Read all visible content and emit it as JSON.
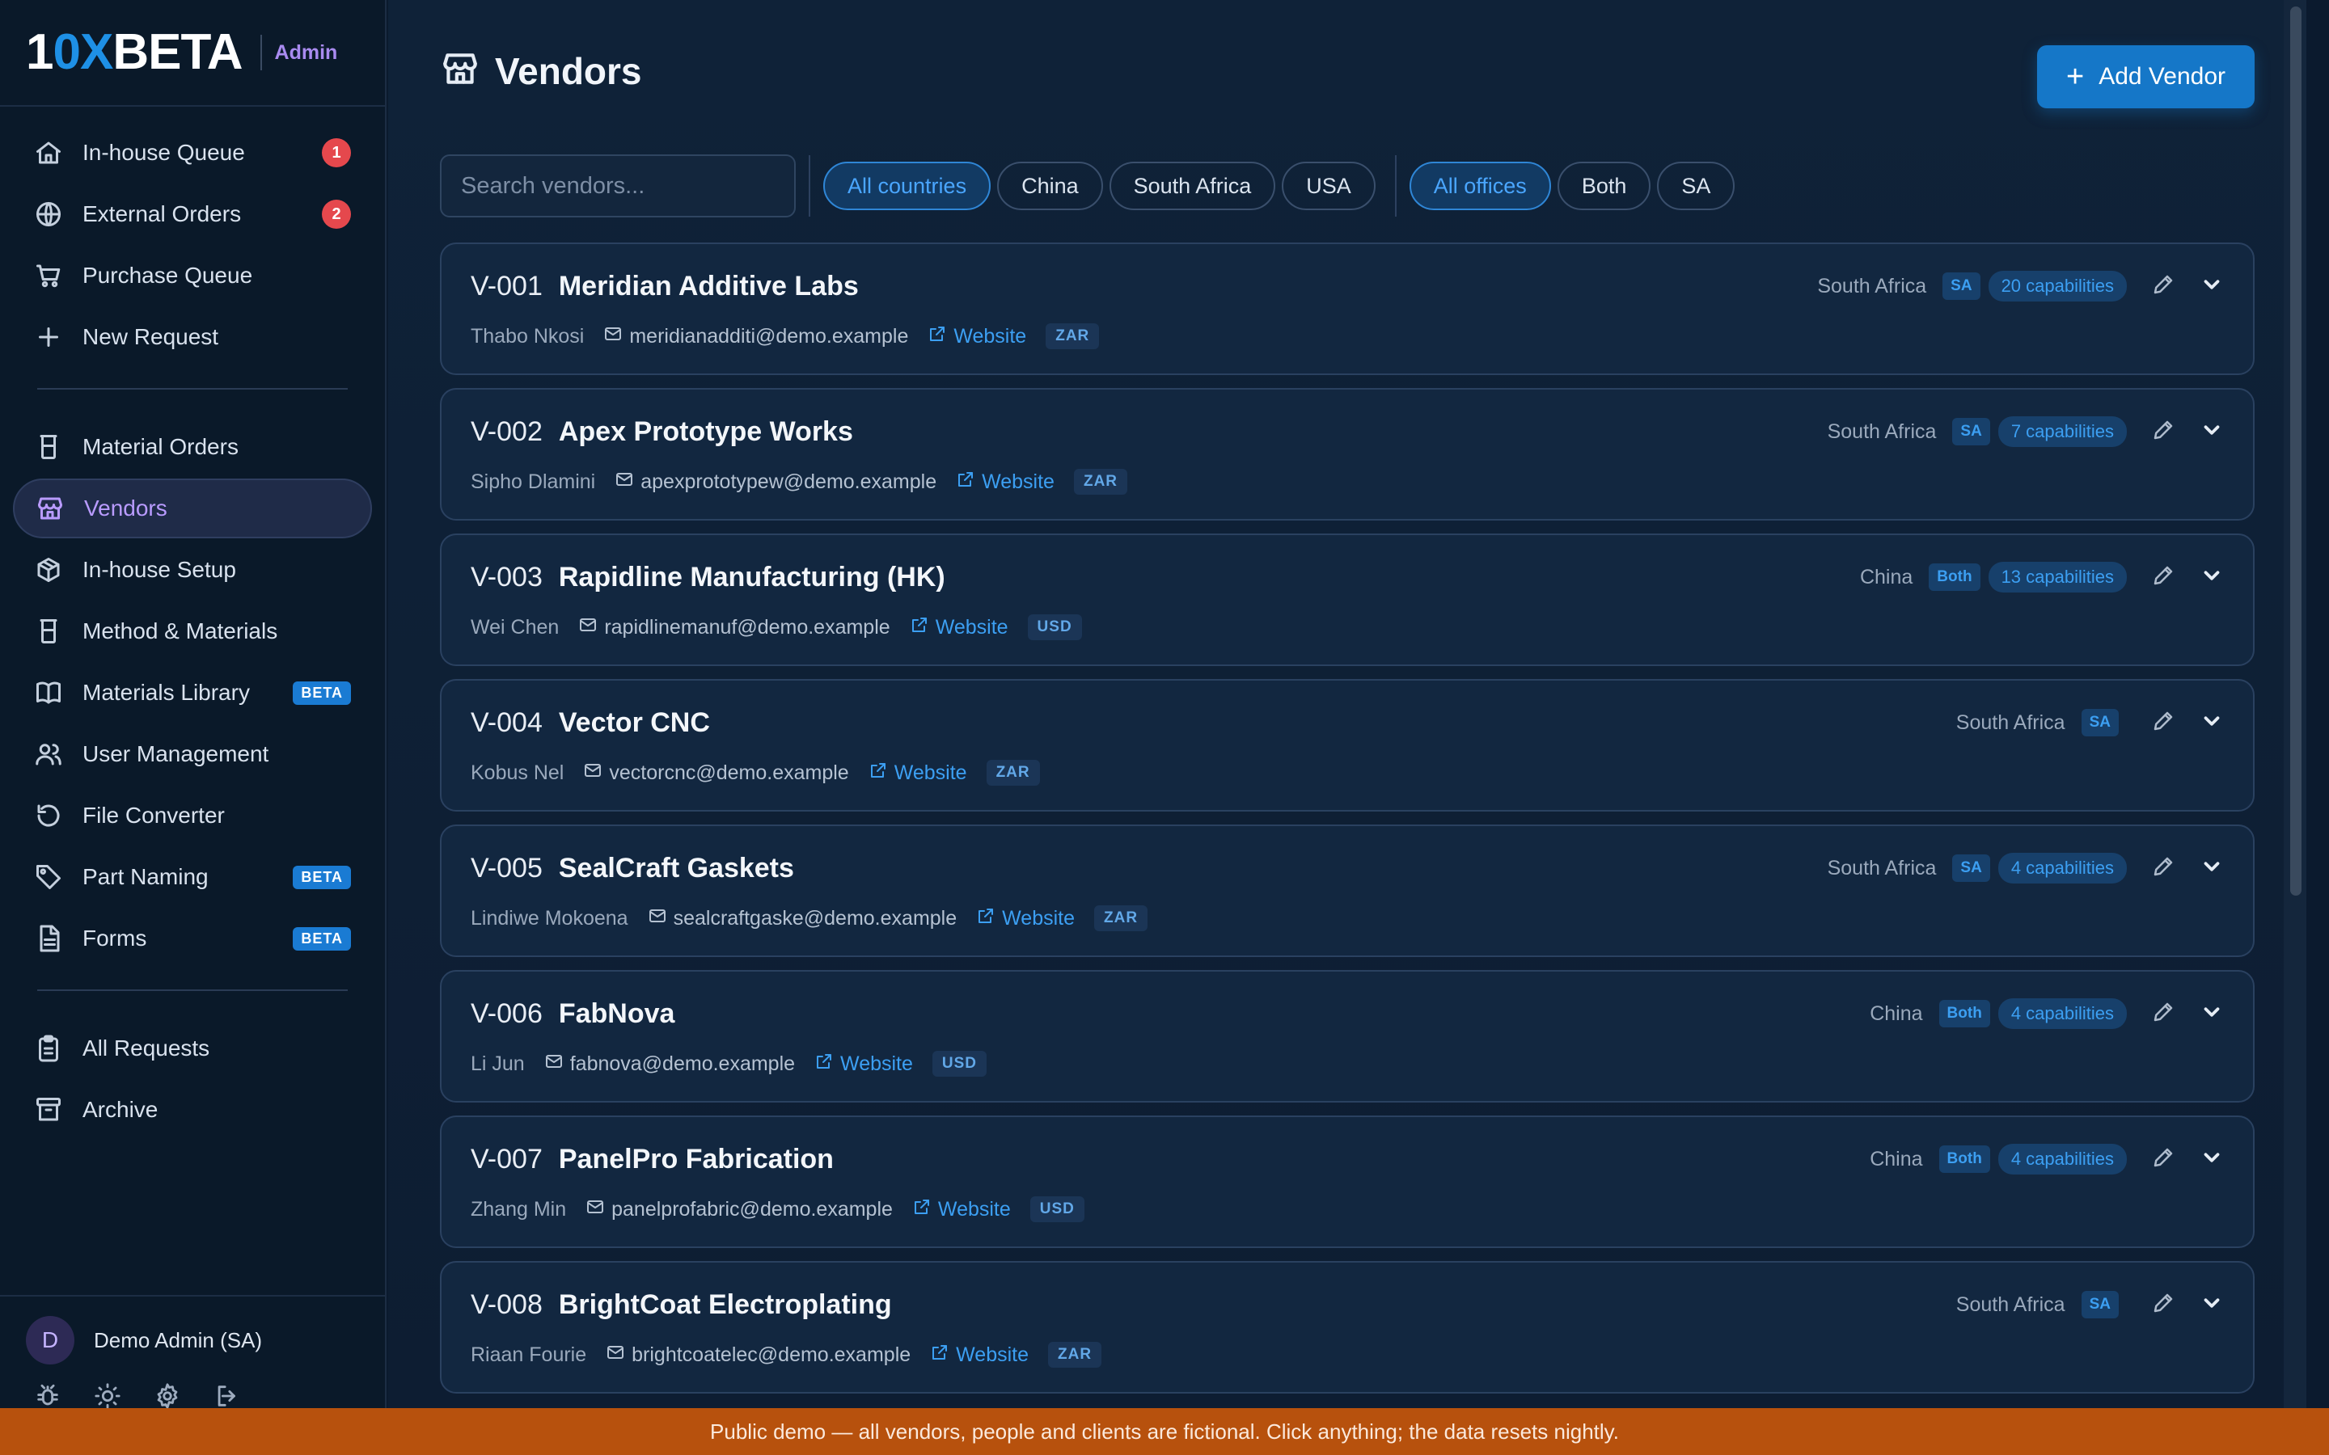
{
  "brand": {
    "logo_prefix": "1",
    "logo_x": "0X",
    "logo_suffix": "BETA",
    "role": "Admin"
  },
  "nav": {
    "group1": [
      {
        "name": "sidebar-item-in-house-queue",
        "icon": "home-icon",
        "label": "In-house Queue",
        "badge": "1"
      },
      {
        "name": "sidebar-item-external-orders",
        "icon": "globe-icon",
        "label": "External Orders",
        "badge": "2"
      },
      {
        "name": "sidebar-item-purchase-queue",
        "icon": "cart-icon",
        "label": "Purchase Queue"
      },
      {
        "name": "sidebar-item-new-request",
        "icon": "plus-icon",
        "label": "New Request"
      }
    ],
    "group2": [
      {
        "name": "sidebar-item-material-orders",
        "icon": "beaker-icon",
        "label": "Material Orders"
      },
      {
        "name": "sidebar-item-vendors",
        "icon": "store-icon",
        "label": "Vendors",
        "active": true
      },
      {
        "name": "sidebar-item-in-house-setup",
        "icon": "box-icon",
        "label": "In-house Setup"
      },
      {
        "name": "sidebar-item-method-materials",
        "icon": "beaker-icon",
        "label": "Method & Materials"
      },
      {
        "name": "sidebar-item-materials-library",
        "icon": "book-icon",
        "label": "Materials Library",
        "beta": "BETA"
      },
      {
        "name": "sidebar-item-user-management",
        "icon": "users-icon",
        "label": "User Management"
      },
      {
        "name": "sidebar-item-file-converter",
        "icon": "refresh-icon",
        "label": "File Converter"
      },
      {
        "name": "sidebar-item-part-naming",
        "icon": "tag-icon",
        "label": "Part Naming",
        "beta": "BETA"
      },
      {
        "name": "sidebar-item-forms",
        "icon": "file-icon",
        "label": "Forms",
        "beta": "BETA"
      }
    ],
    "group3": [
      {
        "name": "sidebar-item-all-requests",
        "icon": "clipboard-icon",
        "label": "All Requests"
      },
      {
        "name": "sidebar-item-archive",
        "icon": "archive-icon",
        "label": "Archive"
      }
    ]
  },
  "user": {
    "initial": "D",
    "name": "Demo Admin (SA)",
    "tools": [
      "bug-icon",
      "sun-icon",
      "gear-icon",
      "logout-icon"
    ]
  },
  "page": {
    "title": "Vendors",
    "add_button": "Add Vendor",
    "add_icon": "+"
  },
  "search": {
    "placeholder": "Search vendors...",
    "value": ""
  },
  "filters": {
    "countries": [
      {
        "label": "All countries",
        "on": true
      },
      {
        "label": "China"
      },
      {
        "label": "South Africa"
      },
      {
        "label": "USA"
      }
    ],
    "offices": [
      {
        "label": "All offices",
        "on": true
      },
      {
        "label": "Both"
      },
      {
        "label": "SA"
      }
    ]
  },
  "vendors": [
    {
      "id": "V-001",
      "name": "Meridian Additive Labs",
      "country": "South Africa",
      "office": "SA",
      "capabilities": "20 capabilities",
      "contact": "Thabo Nkosi",
      "email": "meridianadditi@demo.example",
      "website": "Website",
      "currency": "ZAR"
    },
    {
      "id": "V-002",
      "name": "Apex Prototype Works",
      "country": "South Africa",
      "office": "SA",
      "capabilities": "7 capabilities",
      "contact": "Sipho Dlamini",
      "email": "apexprototypew@demo.example",
      "website": "Website",
      "currency": "ZAR"
    },
    {
      "id": "V-003",
      "name": "Rapidline Manufacturing (HK)",
      "country": "China",
      "office": "Both",
      "capabilities": "13 capabilities",
      "contact": "Wei Chen",
      "email": "rapidlinemanuf@demo.example",
      "website": "Website",
      "currency": "USD"
    },
    {
      "id": "V-004",
      "name": "Vector CNC",
      "country": "South Africa",
      "office": "SA",
      "capabilities": "",
      "contact": "Kobus Nel",
      "email": "vectorcnc@demo.example",
      "website": "Website",
      "currency": "ZAR"
    },
    {
      "id": "V-005",
      "name": "SealCraft Gaskets",
      "country": "South Africa",
      "office": "SA",
      "capabilities": "4 capabilities",
      "contact": "Lindiwe Mokoena",
      "email": "sealcraftgaske@demo.example",
      "website": "Website",
      "currency": "ZAR"
    },
    {
      "id": "V-006",
      "name": "FabNova",
      "country": "China",
      "office": "Both",
      "capabilities": "4 capabilities",
      "contact": "Li Jun",
      "email": "fabnova@demo.example",
      "website": "Website",
      "currency": "USD"
    },
    {
      "id": "V-007",
      "name": "PanelPro Fabrication",
      "country": "China",
      "office": "Both",
      "capabilities": "4 capabilities",
      "contact": "Zhang Min",
      "email": "panelprofabric@demo.example",
      "website": "Website",
      "currency": "USD"
    },
    {
      "id": "V-008",
      "name": "BrightCoat Electroplating",
      "country": "South Africa",
      "office": "SA",
      "capabilities": "",
      "contact": "Riaan Fourie",
      "email": "brightcoatelec@demo.example",
      "website": "Website",
      "currency": "ZAR"
    }
  ],
  "banner": {
    "text": "Public demo — all vendors, people and clients are fictional. Click anything; the data resets nightly."
  },
  "colors": {
    "accent": "#1577c8",
    "active_nav": "#b99bff",
    "banner": "#b7510d",
    "badge": "#e5484d"
  }
}
